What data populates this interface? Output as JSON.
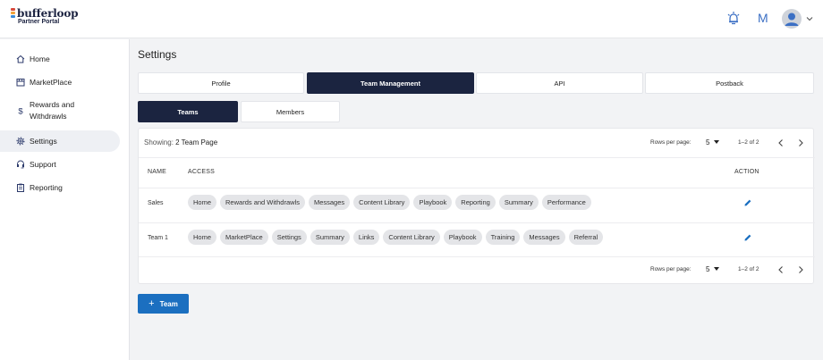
{
  "brand": {
    "name": "bufferloop",
    "subtitle": "Partner Portal"
  },
  "header": {
    "user_initial": "M",
    "icons": [
      "alarm-bell-icon",
      "avatar-icon",
      "chevron-down-icon"
    ]
  },
  "sidebar": {
    "items": [
      {
        "label": "Home",
        "icon": "home-icon"
      },
      {
        "label": "MarketPlace",
        "icon": "store-icon"
      },
      {
        "label": "Rewards and Withdrawls",
        "icon": "dollar-icon"
      },
      {
        "label": "Settings",
        "icon": "gear-icon",
        "active": true
      },
      {
        "label": "Support",
        "icon": "headset-icon"
      },
      {
        "label": "Reporting",
        "icon": "clipboard-icon"
      }
    ]
  },
  "page": {
    "title": "Settings"
  },
  "tabs": [
    {
      "label": "Profile"
    },
    {
      "label": "Team Management",
      "active": true
    },
    {
      "label": "API"
    },
    {
      "label": "Postback"
    }
  ],
  "subtabs": [
    {
      "label": "Teams",
      "active": true
    },
    {
      "label": "Members"
    }
  ],
  "table": {
    "showing_prefix": "Showing:",
    "showing_value": "2 Team Page",
    "rows_per_page_label": "Rows per page:",
    "rows_per_page_value": "5",
    "range": "1–2 of 2",
    "columns": {
      "name": "NAME",
      "access": "ACCESS",
      "action": "ACTION"
    },
    "rows": [
      {
        "name": "Sales",
        "access": [
          "Home",
          "Rewards and Withdrawls",
          "Messages",
          "Content Library",
          "Playbook",
          "Reporting",
          "Summary",
          "Performance"
        ]
      },
      {
        "name": "Team 1",
        "access": [
          "Home",
          "MarketPlace",
          "Settings",
          "Summary",
          "Links",
          "Content Library",
          "Playbook",
          "Training",
          "Messages",
          "Referral"
        ]
      }
    ]
  },
  "add_team": {
    "plus": "+",
    "label": "Team"
  },
  "colors": {
    "navy": "#1b2440",
    "primary": "#1b6fc0",
    "chip": "#e4e5e8",
    "accent_blue": "#3b6fc4"
  }
}
